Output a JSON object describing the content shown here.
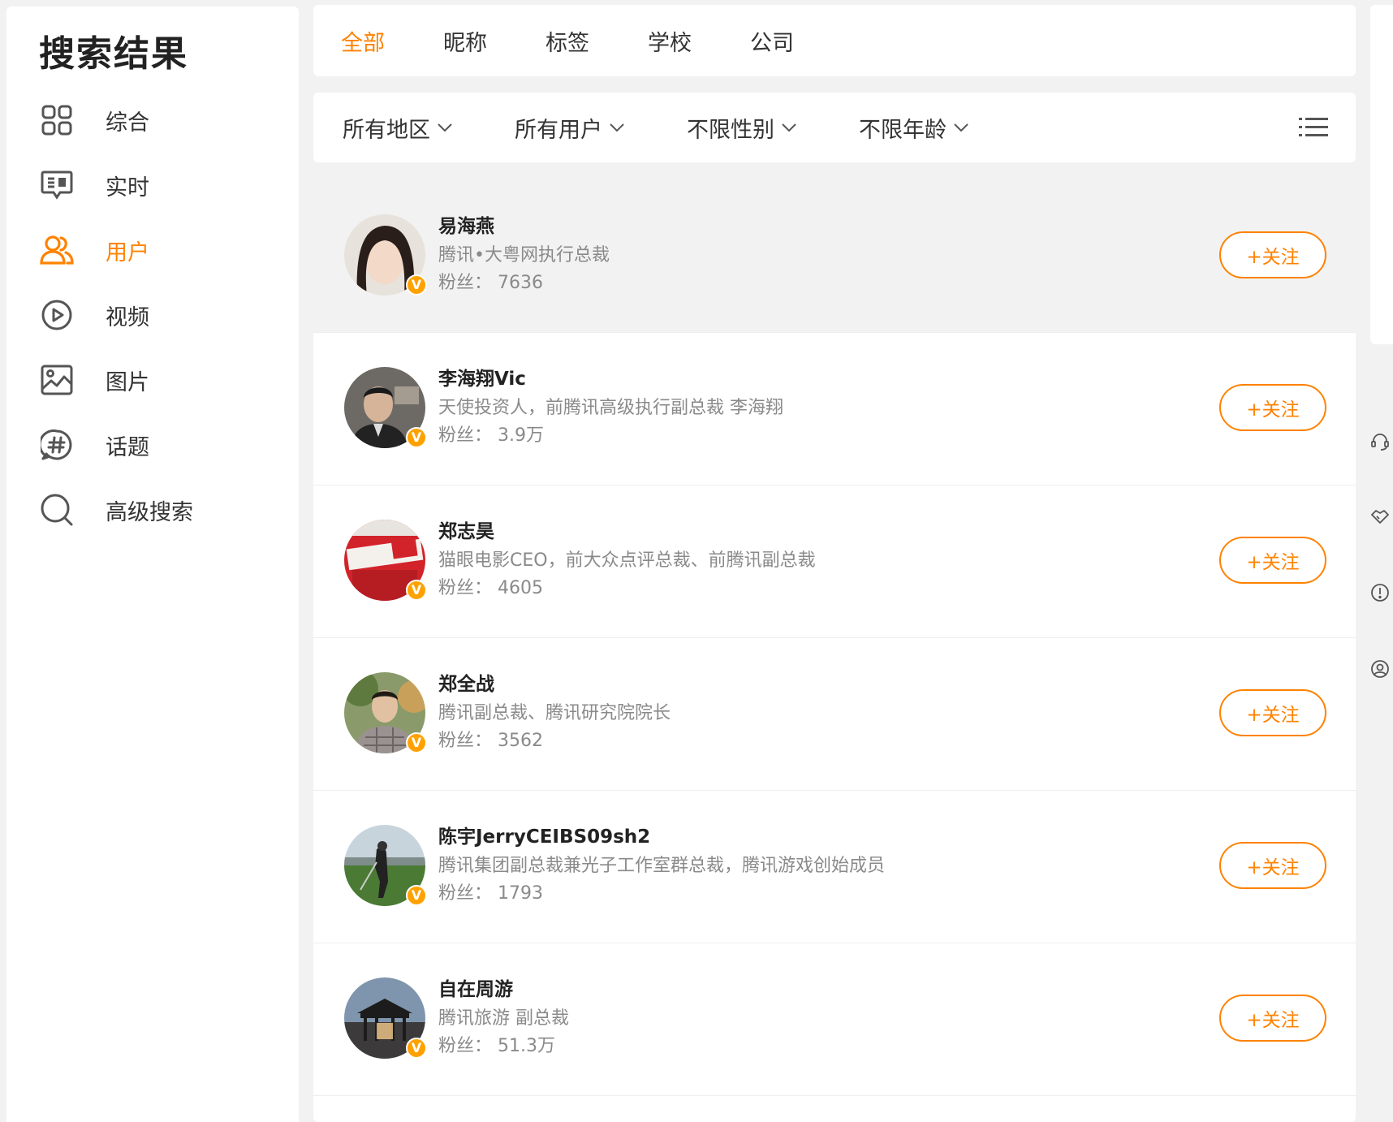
{
  "sidebar": {
    "title": "搜索结果",
    "items": [
      {
        "label": "综合",
        "icon": "grid-icon",
        "active": false
      },
      {
        "label": "实时",
        "icon": "chat-icon",
        "active": false
      },
      {
        "label": "用户",
        "icon": "users-icon",
        "active": true
      },
      {
        "label": "视频",
        "icon": "play-icon",
        "active": false
      },
      {
        "label": "图片",
        "icon": "image-icon",
        "active": false
      },
      {
        "label": "话题",
        "icon": "hashtag-icon",
        "active": false
      },
      {
        "label": "高级搜索",
        "icon": "search-icon",
        "active": false
      }
    ]
  },
  "tabs": [
    {
      "label": "全部",
      "active": true
    },
    {
      "label": "昵称",
      "active": false
    },
    {
      "label": "标签",
      "active": false
    },
    {
      "label": "学校",
      "active": false
    },
    {
      "label": "公司",
      "active": false
    }
  ],
  "filters": [
    {
      "label": "所有地区"
    },
    {
      "label": "所有用户"
    },
    {
      "label": "不限性别"
    },
    {
      "label": "不限年龄"
    }
  ],
  "users": [
    {
      "name": "易海燕",
      "desc": "腾讯•大粤网执行总裁",
      "fans": "粉丝： 7636",
      "follow": "+关注"
    },
    {
      "name": "李海翔Vic",
      "desc": "天使投资人，前腾讯高级执行副总裁 李海翔",
      "fans": "粉丝： 3.9万",
      "follow": "+关注"
    },
    {
      "name": "郑志昊",
      "desc": "猫眼电影CEO，前大众点评总裁、前腾讯副总裁",
      "fans": "粉丝： 4605",
      "follow": "+关注"
    },
    {
      "name": "郑全战",
      "desc": "腾讯副总裁、腾讯研究院院长",
      "fans": "粉丝： 3562",
      "follow": "+关注"
    },
    {
      "name": "陈宇JerryCEIBS09sh2",
      "desc": "腾讯集团副总裁兼光子工作室群总裁，腾讯游戏创始成员",
      "fans": "粉丝： 1793",
      "follow": "+关注"
    },
    {
      "name": "自在周游",
      "desc": "腾讯旅游 副总裁",
      "fans": "粉丝： 51.3万",
      "follow": "+关注"
    }
  ],
  "badge": "V",
  "colors": {
    "accent": "#ff8200",
    "verified": "#ffa200"
  }
}
